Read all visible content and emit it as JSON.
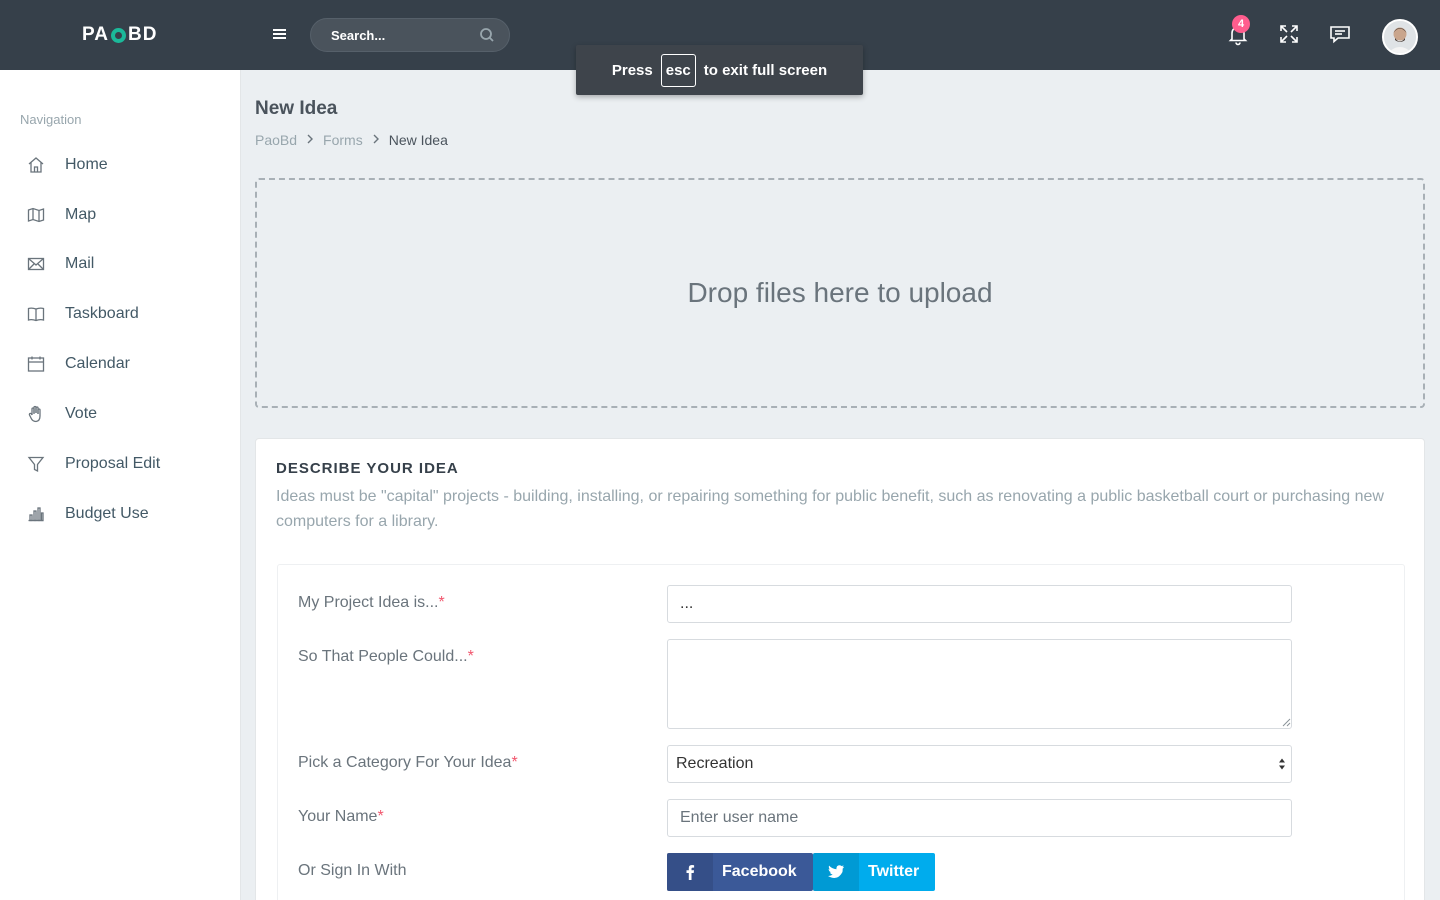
{
  "header": {
    "logo_left": "PA",
    "logo_right": "BD",
    "search_placeholder": "Search...",
    "notification_count": "4",
    "toast_before": "Press",
    "toast_key": "esc",
    "toast_after": "to exit full screen"
  },
  "sidebar": {
    "title": "Navigation",
    "items": [
      {
        "label": "Home",
        "icon": "home-icon"
      },
      {
        "label": "Map",
        "icon": "map-icon"
      },
      {
        "label": "Mail",
        "icon": "mail-icon"
      },
      {
        "label": "Taskboard",
        "icon": "book-icon"
      },
      {
        "label": "Calendar",
        "icon": "calendar-icon"
      },
      {
        "label": "Vote",
        "icon": "hand-icon"
      },
      {
        "label": "Proposal Edit",
        "icon": "filter-icon"
      },
      {
        "label": "Budget Use",
        "icon": "bar-chart-icon"
      }
    ]
  },
  "page": {
    "title": "New Idea",
    "breadcrumb": [
      "PaoBd",
      "Forms",
      "New Idea"
    ]
  },
  "dropzone": {
    "text": "Drop files here to upload"
  },
  "form": {
    "heading": "DESCRIBE YOUR IDEA",
    "description": "Ideas must be \"capital\" projects - building, installing, or repairing something for public benefit, such as renovating a public basketball court or purchasing new computers for a library.",
    "required_mark": "*",
    "project_label": "My Project Idea is...",
    "project_value": "...",
    "people_label": "So That People Could...",
    "people_value": "",
    "category_label": "Pick a Category For Your Idea",
    "category_value": "Recreation",
    "name_label": "Your Name",
    "name_placeholder": "Enter user name",
    "signin_label": "Or Sign In With",
    "facebook_label": "Facebook",
    "twitter_label": "Twitter"
  },
  "colors": {
    "topbar": "#36404a",
    "accent": "#1bb99a",
    "badge": "#ff5d8e",
    "required": "#f1556c",
    "facebook": "#3b5998",
    "twitter": "#00aced"
  }
}
